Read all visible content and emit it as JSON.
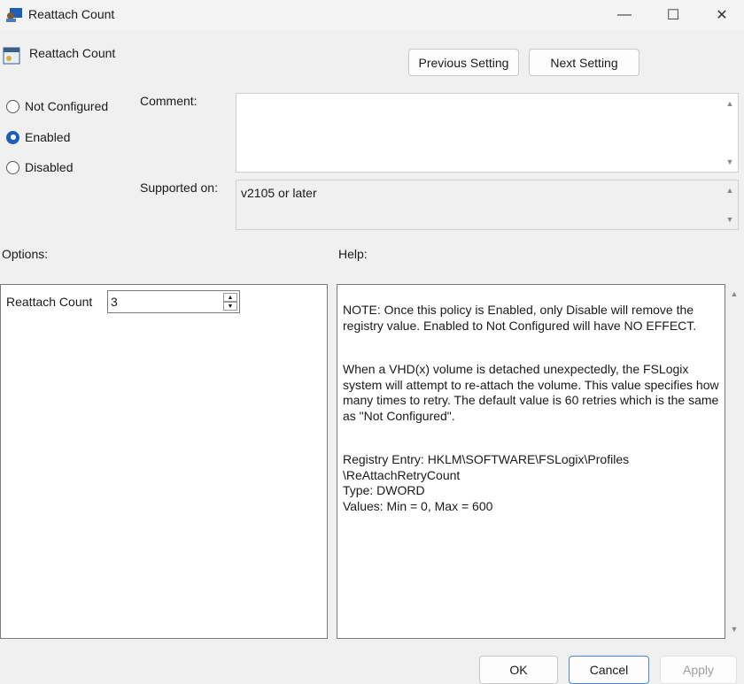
{
  "window": {
    "title": "Reattach Count",
    "minimize": "—",
    "maximize": "☐",
    "close": "✕"
  },
  "header": {
    "title": "Reattach Count",
    "prev": "Previous Setting",
    "next": "Next Setting"
  },
  "state": {
    "options": [
      "Not Configured",
      "Enabled",
      "Disabled"
    ],
    "selected": "Enabled"
  },
  "comment": {
    "label": "Comment:",
    "value": ""
  },
  "supported": {
    "label": "Supported on:",
    "value": "v2105 or later"
  },
  "options": {
    "label": "Options:",
    "field_label": "Reattach Count",
    "field_value": "3"
  },
  "help": {
    "label": "Help:",
    "paragraphs": [
      "NOTE:  Once this policy is Enabled, only Disable will remove the registry value. Enabled to Not Configured will have NO EFFECT.",
      "When a VHD(x) volume is detached unexpectedly, the FSLogix system will attempt to re-attach the volume. This value specifies how many times to retry. The default value is 60 retries which is the same as \"Not Configured\".",
      "Registry Entry:  HKLM\\SOFTWARE\\FSLogix\\Profiles \\ReAttachRetryCount\nType:  DWORD\nValues:  Min = 0, Max = 600"
    ]
  },
  "footer": {
    "ok": "OK",
    "cancel": "Cancel",
    "apply": "Apply"
  }
}
